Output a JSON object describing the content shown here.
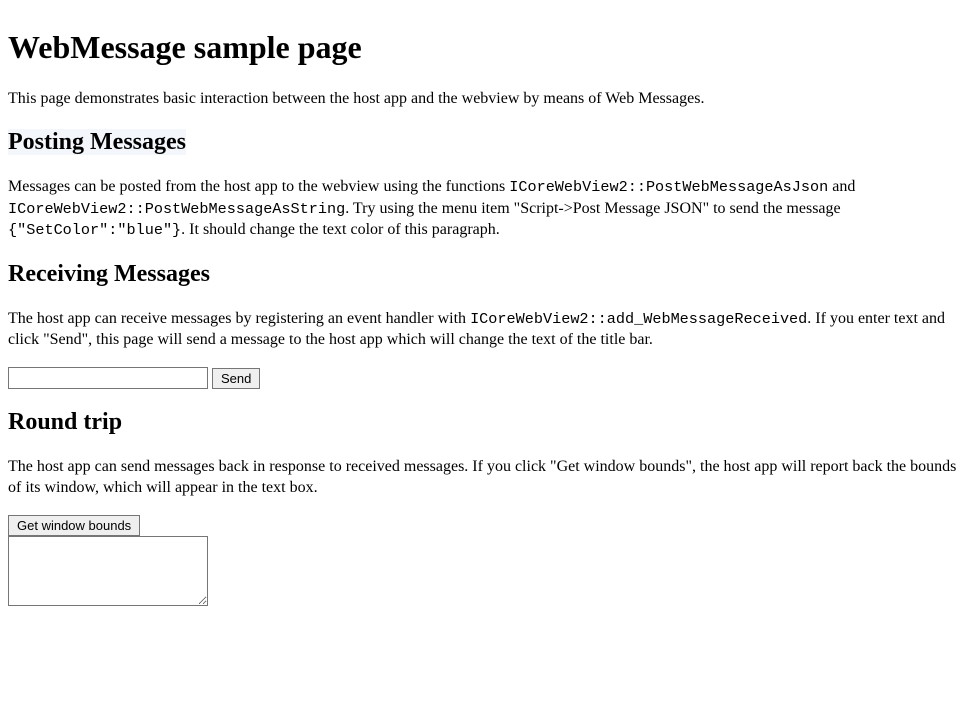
{
  "page": {
    "title": "WebMessage sample page",
    "intro": "This page demonstrates basic interaction between the host app and the webview by means of Web Messages."
  },
  "posting": {
    "heading": "Posting Messages",
    "text_a": "Messages can be posted from the host app to the webview using the functions ",
    "code_1": "ICoreWebView2::PostWebMessageAsJson",
    "text_b": " and ",
    "code_2": "ICoreWebView2::PostWebMessageAsString",
    "text_c": ". Try using the menu item \"Script->Post Message JSON\" to send the message ",
    "code_3": "{\"SetColor\":\"blue\"}",
    "text_d": ". It should change the text color of this paragraph."
  },
  "receiving": {
    "heading": "Receiving Messages",
    "text_a": "The host app can receive messages by registering an event handler with ",
    "code_1": "ICoreWebView2::add_WebMessageReceived",
    "text_b": ". If you enter text and click \"Send\", this page will send a message to the host app which will change the text of the title bar.",
    "input_value": "",
    "send_label": "Send"
  },
  "roundtrip": {
    "heading": "Round trip",
    "text": "The host app can send messages back in response to received messages. If you click \"Get window bounds\", the host app will report back the bounds of its window, which will appear in the text box.",
    "button_label": "Get window bounds",
    "textarea_value": ""
  }
}
